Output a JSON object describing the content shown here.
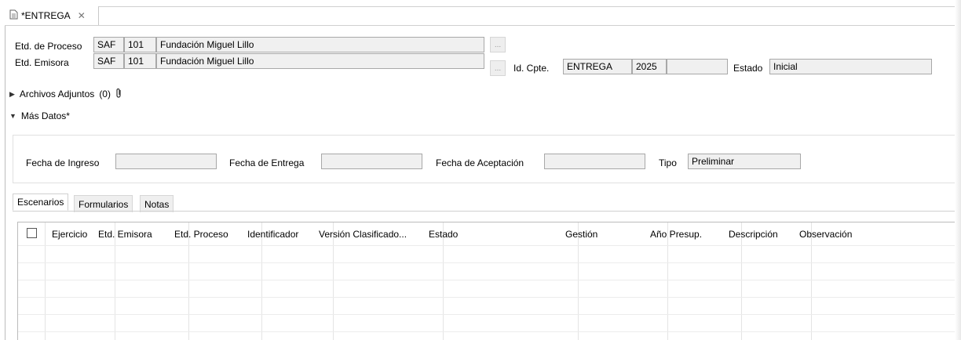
{
  "editor_tab": {
    "title": "*ENTREGA",
    "close_glyph": "✕"
  },
  "header": {
    "proceso_label": "Etd. de Proceso",
    "proceso_code": "SAF",
    "proceso_num": "101",
    "proceso_name": "Fundación Miguel Lillo",
    "emisora_label": "Etd. Emisora",
    "emisora_code": "SAF",
    "emisora_num": "101",
    "emisora_name": "Fundación Miguel Lillo",
    "lookup_glyph": "...",
    "id_cpte_label": "Id. Cpte.",
    "id_cpte_type": "ENTREGA",
    "id_cpte_year": "2025",
    "id_cpte_number": "",
    "estado_label": "Estado",
    "estado_value": "Inicial"
  },
  "sections": {
    "adjuntos_label": "Archivos Adjuntos",
    "adjuntos_count": "(0)",
    "mas_datos_label": "Más Datos*"
  },
  "mas_datos": {
    "fecha_ingreso_label": "Fecha de Ingreso",
    "fecha_ingreso_value": "",
    "fecha_entrega_label": "Fecha de Entrega",
    "fecha_entrega_value": "",
    "fecha_aceptacion_label": "Fecha de Aceptación",
    "fecha_aceptacion_value": "",
    "tipo_label": "Tipo",
    "tipo_value": "Preliminar"
  },
  "inner_tabs": [
    "Escenarios",
    "Formularios",
    "Notas"
  ],
  "table": {
    "columns": [
      "Ejercicio",
      "Etd. Emisora",
      "Etd. Proceso",
      "Identificador",
      "Versión Clasificado...",
      "Estado",
      "Gestión",
      "Año Presup.",
      "Descripción",
      "Observación"
    ],
    "rows": []
  },
  "icons": {
    "editor_tab": "document-icon",
    "attachment": "paperclip-icon",
    "expand": "triangle-right-icon",
    "collapse": "triangle-down-icon"
  }
}
